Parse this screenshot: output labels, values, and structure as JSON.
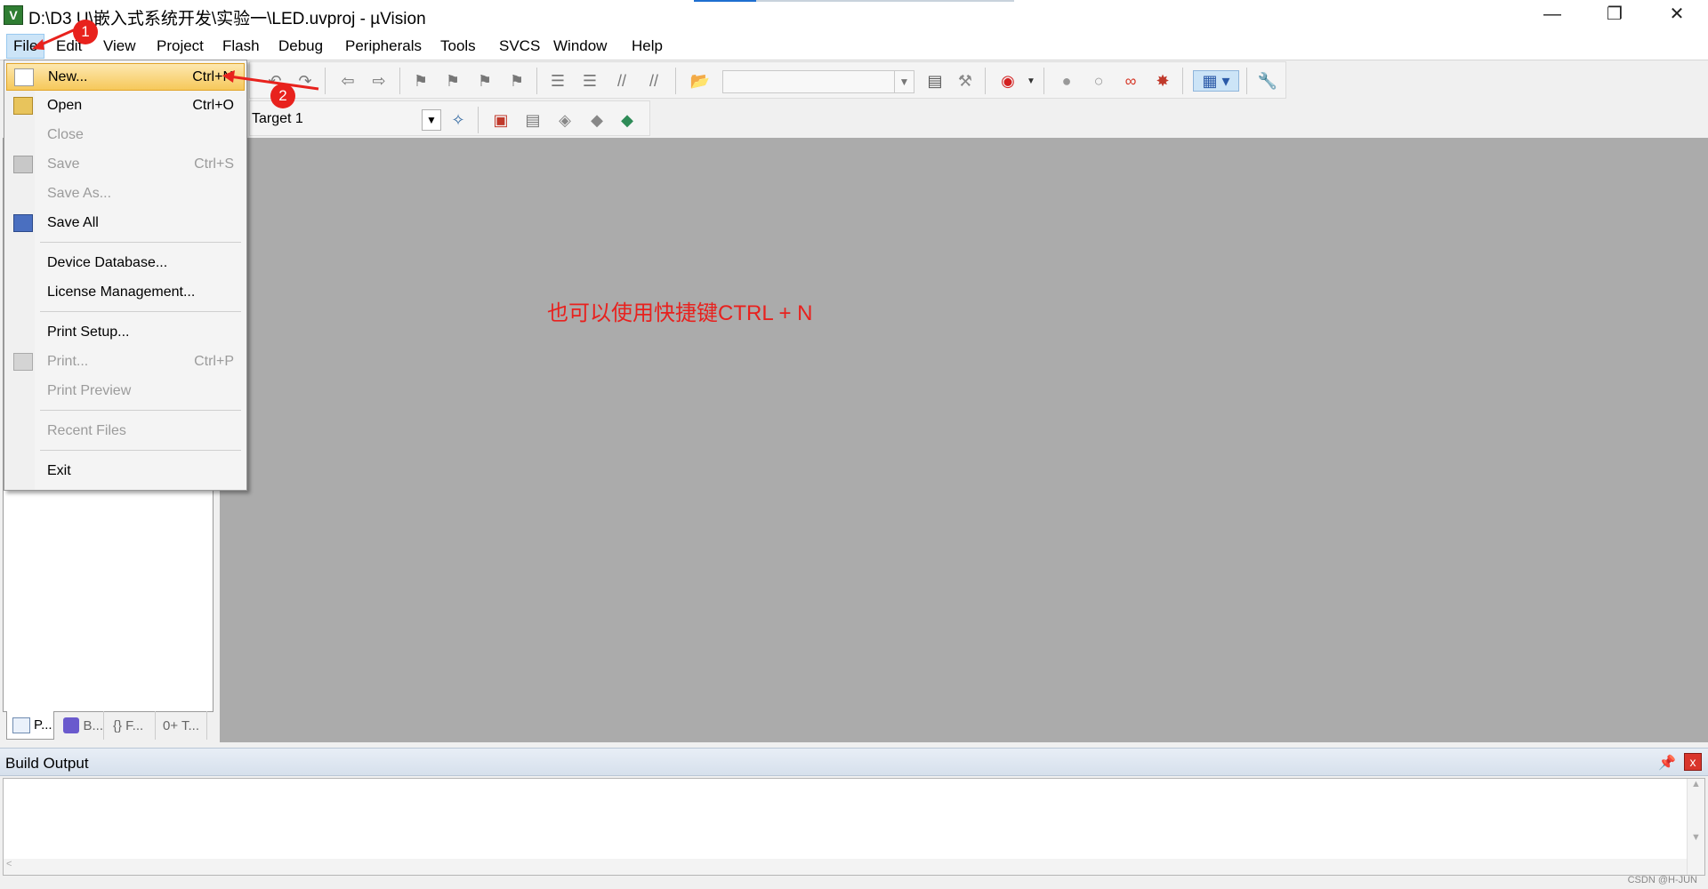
{
  "window": {
    "title": "D:\\D3 U\\嵌入式系统开发\\实验一\\LED.uvproj - µVision",
    "app_icon_letter": "V",
    "minimize": "—",
    "restore": "❐",
    "close": "✕"
  },
  "menubar": {
    "items": [
      "File",
      "Edit",
      "View",
      "Project",
      "Flash",
      "Debug",
      "Peripherals",
      "Tools",
      "SVCS",
      "Window",
      "Help"
    ],
    "active": "File"
  },
  "toolbar2": {
    "target_value": "Target 1"
  },
  "file_menu": {
    "items": [
      {
        "label": "New...",
        "shortcut": "Ctrl+N",
        "enabled": true,
        "highlighted": true
      },
      {
        "label": "Open",
        "shortcut": "Ctrl+O",
        "enabled": true
      },
      {
        "label": "Close",
        "shortcut": "",
        "enabled": false
      },
      {
        "label": "Save",
        "shortcut": "Ctrl+S",
        "enabled": false
      },
      {
        "label": "Save As...",
        "shortcut": "",
        "enabled": false
      },
      {
        "label": "Save All",
        "shortcut": "",
        "enabled": true
      },
      {
        "label": "Device Database...",
        "shortcut": "",
        "enabled": true
      },
      {
        "label": "License Management...",
        "shortcut": "",
        "enabled": true
      },
      {
        "label": "Print Setup...",
        "shortcut": "",
        "enabled": true
      },
      {
        "label": "Print...",
        "shortcut": "Ctrl+P",
        "enabled": false
      },
      {
        "label": "Print Preview",
        "shortcut": "",
        "enabled": false
      },
      {
        "label": "Recent Files",
        "shortcut": "",
        "enabled": false
      },
      {
        "label": "Exit",
        "shortcut": "",
        "enabled": true
      }
    ]
  },
  "project_tabs": [
    "P...",
    "B...",
    "{} F...",
    "0+ T..."
  ],
  "editor": {
    "annotation_text": "也可以使用快捷键CTRL + N"
  },
  "annotations": {
    "marker1": "1",
    "marker2": "2"
  },
  "build_output": {
    "title": "Build Output",
    "pin": "📌",
    "close": "x"
  },
  "watermark": "CSDN @H-JUN",
  "colors": {
    "annotation_red": "#e8211e",
    "menu_highlight": "#f6c85a",
    "editor_bg": "#ababab"
  }
}
